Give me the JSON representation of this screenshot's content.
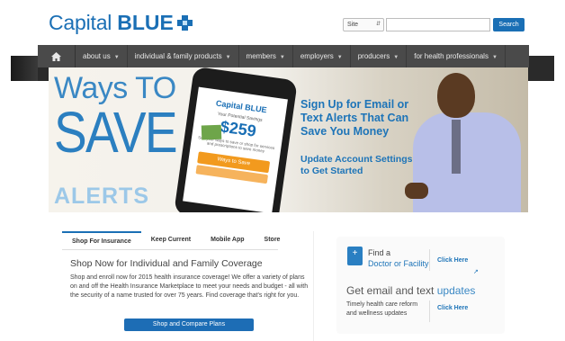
{
  "header": {
    "logo_capital": "Capital",
    "logo_blue": "BLUE",
    "search_select": "Site",
    "search_button": "Search"
  },
  "nav": {
    "items": [
      {
        "label": "about us"
      },
      {
        "label": "individual & family products"
      },
      {
        "label": "members"
      },
      {
        "label": "employers"
      },
      {
        "label": "producers"
      },
      {
        "label": "for health professionals"
      }
    ]
  },
  "hero": {
    "ways_to": "Ways TO",
    "save": "SAVE",
    "alerts": "ALERTS",
    "headline": "Sign Up for Email or Text Alerts That Can Save You Money",
    "update_link": "Update Account Settings to Get Started",
    "phone": {
      "logo": "Capital BLUE",
      "heading": "Your Potential Savings",
      "amount": "$259",
      "note": "See your ways to save or shop for services and prescriptions to save money",
      "button": "Ways to Save"
    }
  },
  "tabs": {
    "items": [
      "Shop For Insurance",
      "Keep Current",
      "Mobile App",
      "Store"
    ],
    "active": "Shop For Insurance"
  },
  "panel": {
    "title": "Shop Now for Individual and Family Coverage",
    "body": "Shop and enroll now for 2015 health insurance coverage! We offer a variety of plans on and off the Health Insurance Marketplace to meet your needs and budget - all with the security of a name trusted for over 75 years. Find coverage that's right for you.",
    "button": "Shop and Compare Plans"
  },
  "right": {
    "find_label": "Find a",
    "find_link": "Doctor or Facility",
    "click_here_1": "Click Here",
    "email_title_prefix": "Get email and text ",
    "email_title_highlight": "updates",
    "email_text": "Timely health care reform and wellness updates",
    "click_here_2": "Click Here"
  },
  "colors": {
    "brand_blue": "#1a6fb5",
    "nav_bg": "#4a4a4a",
    "accent_orange": "#f29a1e"
  }
}
